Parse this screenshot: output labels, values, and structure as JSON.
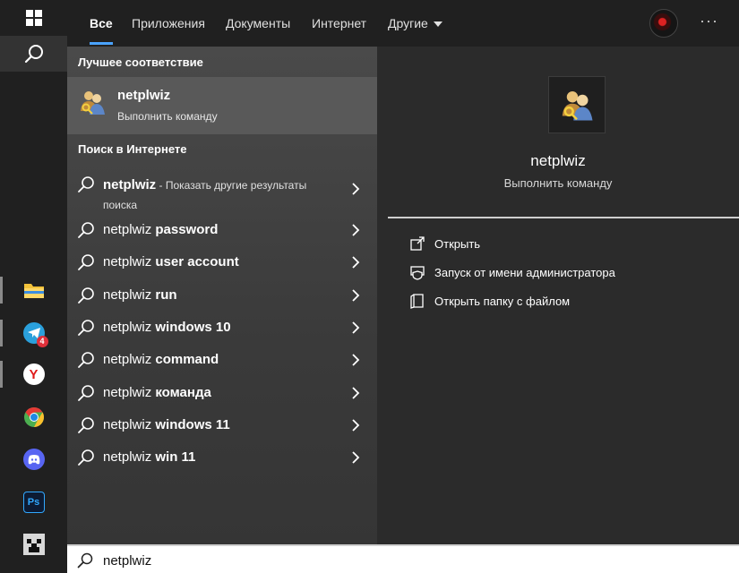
{
  "taskbar": {
    "apps": [
      {
        "name": "file-explorer",
        "color": "#f3c23a"
      },
      {
        "name": "telegram",
        "color": "#2aa0dc",
        "badge": "4"
      },
      {
        "name": "yandex-browser",
        "color": "#ffffff",
        "glyph": "Y"
      },
      {
        "name": "chrome",
        "color": "#4caf50"
      },
      {
        "name": "discord",
        "color": "#5865f2"
      },
      {
        "name": "photoshop",
        "color": "#0d1b33",
        "glyph": "Ps"
      },
      {
        "name": "minecraft",
        "color": "#cfcfcf"
      }
    ]
  },
  "tabs": [
    {
      "label": "Все",
      "active": true
    },
    {
      "label": "Приложения"
    },
    {
      "label": "Документы"
    },
    {
      "label": "Интернет"
    },
    {
      "label": "Другие",
      "dropdown": true
    }
  ],
  "more_label": "···",
  "best_match": {
    "section": "Лучшее соответствие",
    "name": "netplwiz",
    "subtitle": "Выполнить команду"
  },
  "web": {
    "section": "Поиск в Интернете",
    "first": {
      "query": "netplwiz",
      "suffix": " - Показать другие результаты поиска"
    },
    "suggestions": [
      {
        "prefix": "netplwiz",
        "bold": " password"
      },
      {
        "prefix": "netplwiz",
        "bold": " user account"
      },
      {
        "prefix": "netplwiz",
        "bold": " run"
      },
      {
        "prefix": "netplwiz",
        "bold": " windows 10"
      },
      {
        "prefix": "netplwiz",
        "bold": " command"
      },
      {
        "prefix": "netplwiz",
        "bold": " команда"
      },
      {
        "prefix": "netplwiz",
        "bold": " windows 11"
      },
      {
        "prefix": "netplwiz",
        "bold": " win 11"
      }
    ]
  },
  "detail": {
    "title": "netplwiz",
    "subtitle": "Выполнить команду",
    "actions": [
      {
        "label": "Открыть",
        "icon": "open-icon"
      },
      {
        "label": "Запуск от имени администратора",
        "icon": "admin-shield-icon"
      },
      {
        "label": "Открыть папку с файлом",
        "icon": "folder-icon"
      }
    ]
  },
  "search": {
    "value": "netplwiz"
  },
  "colors": {
    "accent": "#4aa3ff",
    "selected_row": "#595959",
    "panel": "#2b2b2b"
  }
}
